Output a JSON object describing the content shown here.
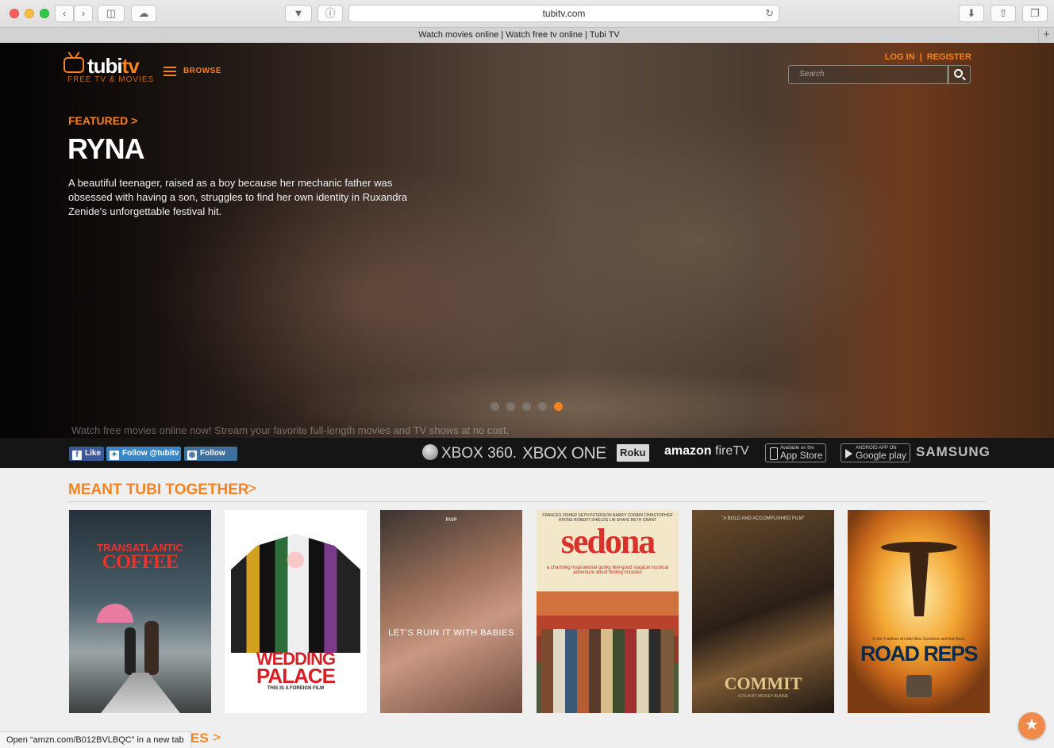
{
  "browser": {
    "url": "tubitv.com",
    "tab_title": "Watch movies online | Watch free tv online | Tubi TV",
    "new_tab": "+"
  },
  "header": {
    "logo": "tubitv",
    "logo_tagline": "FREE TV & MOVIES",
    "browse_label": "BROWSE",
    "login_label": "LOG IN",
    "auth_separator": "|",
    "register_label": "REGISTER",
    "search_placeholder": "Search"
  },
  "hero": {
    "featured_label": "FEATURED  >",
    "title": "RYNA",
    "description": "A beautiful teenager, raised as a boy because her mechanic father was obsessed with having a son, struggles to find her own identity in Ruxandra Zenide's unforgettable festival hit.",
    "carousel": {
      "count": 5,
      "active_index": 4
    },
    "tagline": "Watch free movies online now! Stream your favorite full-length movies and TV shows at no cost."
  },
  "social": {
    "facebook_label": "Like",
    "twitter_label": "Follow @tubitv",
    "instagram_label": "Follow"
  },
  "platforms": {
    "xbox360": "XBOX 360.",
    "xboxone": "XBOX ONE",
    "roku": "Roku",
    "amazon": "amazon",
    "firetv": "fireTV",
    "appstore_small": "Available on the",
    "appstore": "App Store",
    "googleplay_small": "ANDROID APP ON",
    "googleplay": "Google play",
    "samsung": "SAMSUNG"
  },
  "section": {
    "title": "MEANT TUBI TOGETHER",
    "arrow": ">"
  },
  "posters": [
    {
      "line1": "TRANSATLANTIC",
      "line2": "COFFEE"
    },
    {
      "line1": "WEDDING",
      "line2": "PALACE",
      "line3": "THIS IS A FOREIGN FILM"
    },
    {
      "top": "RVIP",
      "line1": "LET'S RUIN IT WITH BABIES"
    },
    {
      "top": "FRANCES FISHER   SETH PETERSON   BARRY CORBIN   CHRISTOPHER ATKINS   ROBERT SHIELDS   LIN SHAYE   BETH GRANT",
      "line1": "sedona",
      "line2": "a charming inspirational quirky feel-good magical mystical adventure about finding miracles"
    },
    {
      "top": "\"A BOLD AND ACCOMPLISHED FILM\"",
      "line1": "COMMIT",
      "line2": "A FILM BY MICKEY BLAINE"
    },
    {
      "small": "In the Tradition of Little Miss Sunshine and Rat Race",
      "line1": "ROAD REPS"
    }
  ],
  "status_bar": "Open “amzn.com/B012BVLBQC” in a new tab",
  "language": {
    "code": "ES",
    "arrow": ">"
  },
  "fab_icon": "star-icon",
  "colors": {
    "accent": "#f5821f",
    "platform_bar": "#151515",
    "background": "#efefef"
  }
}
